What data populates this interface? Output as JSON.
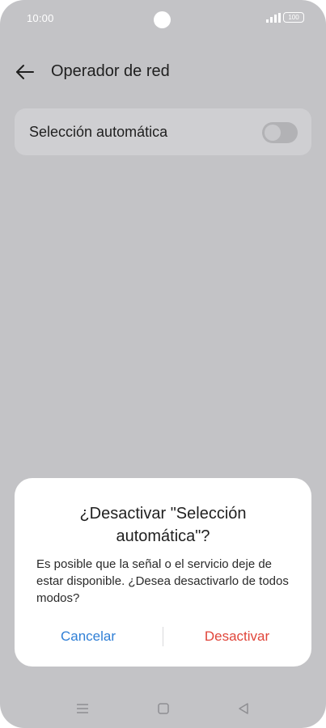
{
  "status_bar": {
    "time": "10:00",
    "battery": "100"
  },
  "app_bar": {
    "title": "Operador de red"
  },
  "settings": {
    "auto_selection_label": "Selección automática",
    "auto_selection_enabled": false
  },
  "dialog": {
    "title": "¿Desactivar \"Selección automática\"?",
    "message": "Es posible que la señal o el servicio deje de estar disponible. ¿Desea desactivarlo de todos modos?",
    "cancel_label": "Cancelar",
    "confirm_label": "Desactivar"
  },
  "colors": {
    "cancel": "#2f7fd6",
    "confirm": "#e0453a",
    "overlay_background": "#c3c3c6"
  },
  "icons": {
    "back": "arrow-left-icon",
    "signal": "signal-icon",
    "battery": "battery-icon",
    "nav_menu": "menu-icon",
    "nav_home": "home-icon",
    "nav_back": "triangle-back-icon"
  }
}
